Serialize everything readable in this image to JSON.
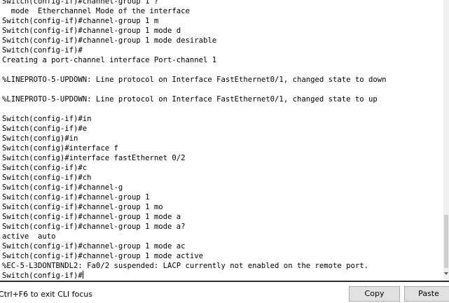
{
  "terminal": {
    "lines": [
      "Switch(config-if)#channel-group 1 ?",
      "  mode  Etherchannel Mode of the interface",
      "Switch(config-if)#channel-group 1 m",
      "Switch(config-if)#channel-group 1 mode d",
      "Switch(config-if)#channel-group 1 mode desirable",
      "Switch(config-if)#",
      "Creating a port-channel interface Port-channel 1",
      "",
      "%LINEPROTO-5-UPDOWN: Line protocol on Interface FastEthernet0/1, changed state to down",
      "",
      "%LINEPROTO-5-UPDOWN: Line protocol on Interface FastEthernet0/1, changed state to up",
      "",
      "Switch(config-if)#in",
      "Switch(config-if)#e",
      "Switch(config)#in",
      "Switch(config)#interface f",
      "Switch(config)#interface fastEthernet 0/2",
      "Switch(config-if)#c",
      "Switch(config-if)#ch",
      "Switch(config-if)#channel-g",
      "Switch(config-if)#channel-group 1",
      "Switch(config-if)#channel-group 1 mo",
      "Switch(config-if)#channel-group 1 mode a",
      "Switch(config-if)#channel-group 1 mode a?",
      "active  auto",
      "Switch(config-if)#channel-group 1 mode ac",
      "Switch(config-if)#channel-group 1 mode active",
      "%EC-5-L3DONTBNDL2: Fa0/2 suspended: LACP currently not enabled on the remote port.",
      "Switch(config-if)#"
    ]
  },
  "footer": {
    "hint": "Ctrl+F6 to exit CLI focus",
    "copy_label": "Copy",
    "paste_label": "Paste"
  },
  "icons": {
    "scroll_down": "chevron-down-icon"
  }
}
